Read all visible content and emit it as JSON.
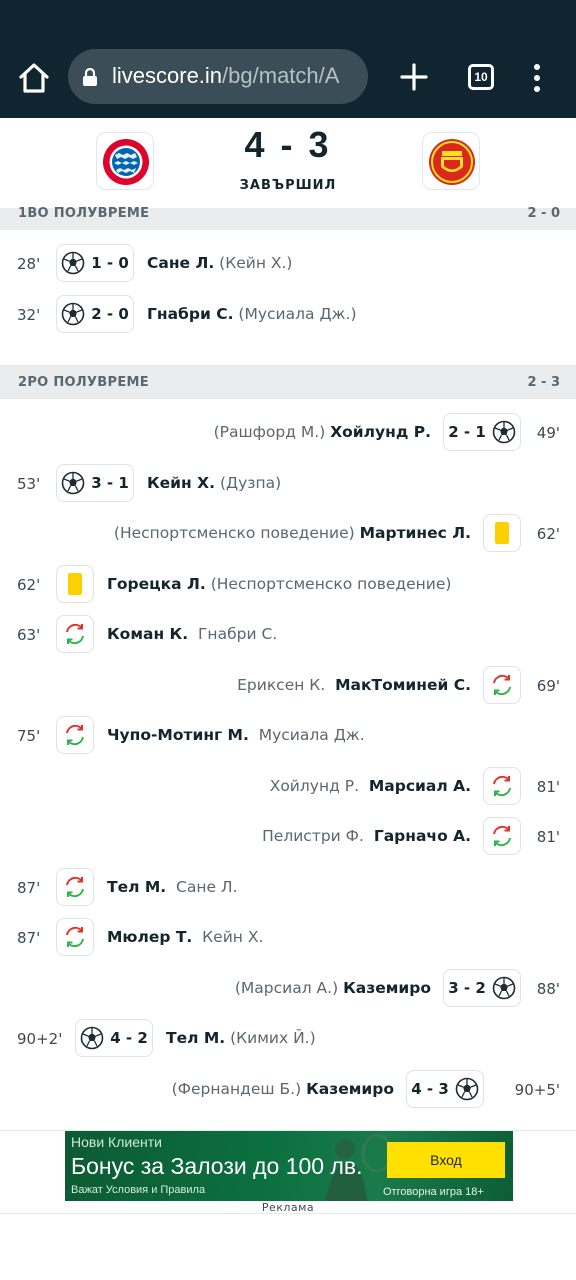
{
  "browser": {
    "url_domain": "livescore.in",
    "url_path": "/bg/match/A",
    "tab_count": "10"
  },
  "match": {
    "score": "4 - 3",
    "status": "ЗАВЪРШИЛ",
    "home_team_logo": "FC Bayern München",
    "away_team_logo": "Manchester United"
  },
  "first_half": {
    "label": "1ВО ПОЛУВРЕМЕ",
    "score": "2 - 0",
    "events": [
      {
        "minute": "28'",
        "score": "1 - 0",
        "player": "Сане Л.",
        "extra": "(Кейн Х.)"
      },
      {
        "minute": "32'",
        "score": "2 - 0",
        "player": "Гнабри С.",
        "extra": "(Мусиала Дж.)"
      }
    ]
  },
  "second_half": {
    "label": "2РО ПОЛУВРЕМЕ",
    "score": "2 - 3",
    "events": [
      {
        "side": "away",
        "type": "goal",
        "minute": "49'",
        "score": "2 - 1",
        "player": "Хойлунд Р.",
        "extra": "(Рашфорд М.)"
      },
      {
        "side": "home",
        "type": "goal",
        "minute": "53'",
        "score": "3 - 1",
        "player": "Кейн Х.",
        "extra": "(Дузпа)"
      },
      {
        "side": "away",
        "type": "yellow",
        "minute": "62'",
        "player": "Мартинес Л.",
        "extra": "(Неспортсменско поведение)"
      },
      {
        "side": "home",
        "type": "yellow",
        "minute": "62'",
        "player": "Горецка Л.",
        "extra": "(Неспортсменско поведение)"
      },
      {
        "side": "home",
        "type": "sub",
        "minute": "63'",
        "player": "Коман К.",
        "extra": "Гнабри С."
      },
      {
        "side": "away",
        "type": "sub",
        "minute": "69'",
        "player": "МакТоминей С.",
        "extra": "Ериксен К."
      },
      {
        "side": "home",
        "type": "sub",
        "minute": "75'",
        "player": "Чупо-Мотинг М.",
        "extra": "Мусиала Дж."
      },
      {
        "side": "away",
        "type": "sub",
        "minute": "81'",
        "player": "Марсиал А.",
        "extra": "Хойлунд Р."
      },
      {
        "side": "away",
        "type": "sub",
        "minute": "81'",
        "player": "Гарначо А.",
        "extra": "Пелистри Ф."
      },
      {
        "side": "home",
        "type": "sub",
        "minute": "87'",
        "player": "Тел М.",
        "extra": "Сане Л."
      },
      {
        "side": "home",
        "type": "sub",
        "minute": "87'",
        "player": "Мюлер Т.",
        "extra": "Кейн Х."
      },
      {
        "side": "away",
        "type": "goal",
        "minute": "88'",
        "score": "3 - 2",
        "player": "Каземиро",
        "extra": "(Марсиал А.)"
      },
      {
        "side": "home",
        "type": "goal",
        "minute": "90+2'",
        "score": "4 - 2",
        "player": "Тел М.",
        "extra": "(Кимих Й.)"
      },
      {
        "side": "away",
        "type": "goal",
        "minute": "90+5'",
        "score": "4 - 3",
        "player": "Каземиро",
        "extra": "(Фернандеш Б.)"
      }
    ]
  },
  "ad": {
    "headline_small": "Нови Клиенти",
    "headline": "Бонус за Залози до 100 лв.",
    "terms": "Важат Условия и Правила",
    "button": "Вход",
    "responsible": "Отговорна игра  18+",
    "label": "Реклама"
  },
  "colors": {
    "chrome": "#0f2530",
    "yellow_card": "#ffd000",
    "sub_in": "#2fb34a",
    "sub_out": "#e0322b"
  }
}
